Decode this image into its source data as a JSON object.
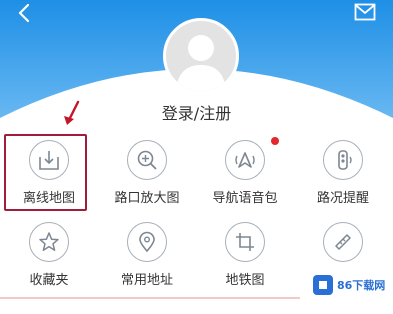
{
  "header": {
    "colors": {
      "top": "#1e8fe6",
      "bottom": "#7cc3f5",
      "accent": "#a11c3a",
      "badge": "#e3272f"
    },
    "back_icon": "chevron-left-icon",
    "mail_icon": "mail-icon",
    "avatar_icon": "user-silhouette-icon",
    "login_label": "登录/注册"
  },
  "menu": {
    "items": [
      {
        "label": "离线地图",
        "icon": "download-map-icon",
        "selected": true
      },
      {
        "label": "路口放大图",
        "icon": "intersection-zoom-icon"
      },
      {
        "label": "导航语音包",
        "icon": "voice-pack-icon",
        "badge": true
      },
      {
        "label": "路况提醒",
        "icon": "traffic-alert-icon"
      },
      {
        "label": "收藏夹",
        "icon": "star-icon"
      },
      {
        "label": "常用地址",
        "icon": "location-pin-icon"
      },
      {
        "label": "地铁图",
        "icon": "crop-frame-icon"
      },
      {
        "label": "",
        "icon": "ruler-icon"
      }
    ]
  },
  "watermark": {
    "text": "86下载网",
    "logo_icon": "watermark-logo-icon"
  }
}
